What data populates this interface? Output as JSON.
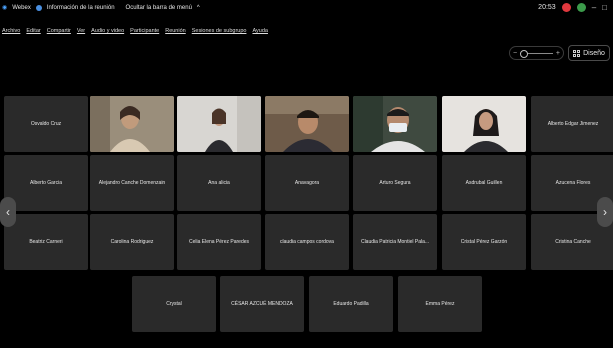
{
  "titlebar": {
    "app_name": "Webex",
    "meeting_info": "Información de la reunión",
    "hide_menu": "Ocultar la barra de menú",
    "hide_menu_arrow": "^",
    "clock": "20:53",
    "minimize": "–",
    "close": "□"
  },
  "menu": [
    "Archivo",
    "Editar",
    "Compartir",
    "Ver",
    "Audio y video",
    "Participante",
    "Reunión",
    "Sesiones de subgrupo",
    "Ayuda"
  ],
  "zoom": {
    "minus": "−",
    "plus": "+",
    "level": 0.1
  },
  "layout_button": {
    "label": "Diseño"
  },
  "participants": {
    "row1": [
      "Osvaldo Cruz",
      "",
      "",
      "",
      "",
      "",
      "Alberto Edgar Jimenez"
    ],
    "row2": [
      "Alberto Garcia",
      "Alejandro Canche Domenzain",
      "Ana alicia",
      "Anavagora",
      "Arturo Segura",
      "Asdrubal Guillen",
      "Azucena Flores"
    ],
    "row3": [
      "Beatriz Carneri",
      "Carolina Rodriguez",
      "Celia Elena Pérez Paredes",
      "claudia campos cordova",
      "Claudia Patricia Montiel Pala...",
      "Cristal Pérez Garzón",
      "Cristina Canche"
    ],
    "row4": [
      "Crystal",
      "CÉSAR AZCUÉ MENDOZA",
      "Eduardo Padilla",
      "Emma Pérez"
    ]
  },
  "nav": {
    "prev": "‹",
    "next": "›"
  },
  "colors": {
    "background": "#000000",
    "tile": "#2a2a2a",
    "accent_red": "#e0383e",
    "accent_green": "#3c9b4b"
  }
}
